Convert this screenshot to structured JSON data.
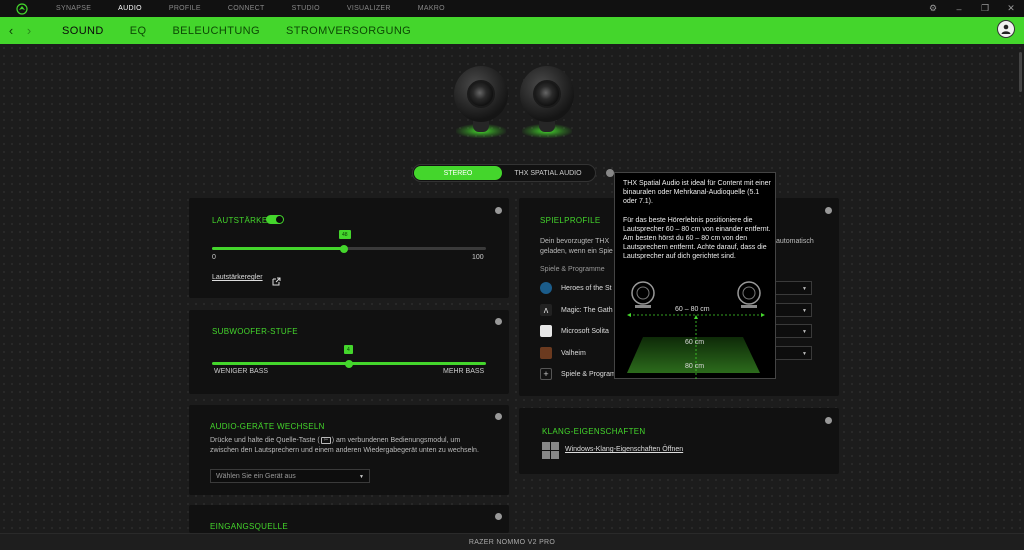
{
  "topnav": {
    "items": [
      {
        "label": "SYNAPSE",
        "active": false
      },
      {
        "label": "AUDIO",
        "active": true
      },
      {
        "label": "PROFILE",
        "active": false
      },
      {
        "label": "CONNECT",
        "active": false
      },
      {
        "label": "STUDIO",
        "active": false
      },
      {
        "label": "VISUALIZER",
        "active": false
      },
      {
        "label": "MAKRO",
        "active": false
      }
    ]
  },
  "subnav": {
    "tabs": [
      {
        "label": "SOUND",
        "active": true
      },
      {
        "label": "EQ",
        "active": false
      },
      {
        "label": "BELEUCHTUNG",
        "active": false
      },
      {
        "label": "STROMVERSORGUNG",
        "active": false
      }
    ]
  },
  "mode_toggle": {
    "stereo": "STEREO",
    "thx": "THX SPATIAL AUDIO",
    "selected": "STEREO"
  },
  "volume": {
    "title": "LAUTSTÄRKE",
    "enabled": true,
    "value": 48,
    "value_label": "48",
    "min_label": "0",
    "max_label": "100",
    "link": "Lautstärkeregler"
  },
  "subwoofer": {
    "title": "SUBWOOFER-STUFE",
    "value_label": "4",
    "level": 0.5,
    "min_label": "WENIGER BASS",
    "max_label": "MEHR BASS"
  },
  "audio_devices": {
    "title": "AUDIO-GERÄTE WECHSELN",
    "text_before": "Drücke und halte die Quelle-Taste (",
    "text_after": ") am verbundenen Bedienungsmodul, um zwischen den Lautsprechern und einem anderen Wiedergabegerät unten zu wechseln.",
    "placeholder": "Wählen Sie ein Gerät aus"
  },
  "input_source": {
    "title": "EINGANGSQUELLE"
  },
  "spielprofile": {
    "title": "SPIELPROFILE",
    "desc_left": "Dein bevorzugter THX",
    "desc_left2": "geladen, wenn ein Spie",
    "desc_right": "automatisch",
    "subheading": "Spiele & Programme",
    "games": [
      {
        "name": "Heroes of the St",
        "eq": "EQ"
      },
      {
        "name": "Magic: The Gath",
        "eq": "EQ"
      },
      {
        "name": "Microsoft Solita",
        "eq": "EQ"
      },
      {
        "name": "Valheim",
        "eq": "EQ"
      }
    ],
    "add_label": "Spiele & Program"
  },
  "klang": {
    "title": "KLANG-EIGENSCHAFTEN",
    "link": "Windows-Klang-Eigenschaften Öffnen"
  },
  "tooltip": {
    "para1": "THX Spatial Audio ist ideal für Content mit einer binauralen oder Mehrkanal-Audioquelle (5.1 oder 7.1).",
    "para2": "Für das beste Hörerlebnis positioniere die Lautsprecher 60 – 80 cm von einander entfernt. Am besten hörst du 60 – 80 cm von den Lautsprechern entfernt. Achte darauf, dass die Lautsprecher auf dich gerichtet sind.",
    "dist_horizontal": "60 – 80 cm",
    "dist_60": "60 cm",
    "dist_80": "80 cm"
  },
  "footer": {
    "device": "RAZER NOMMO V2 PRO"
  },
  "colors": {
    "accent": "#44d62c",
    "panel": "#111111",
    "background": "#1c1c1c"
  }
}
